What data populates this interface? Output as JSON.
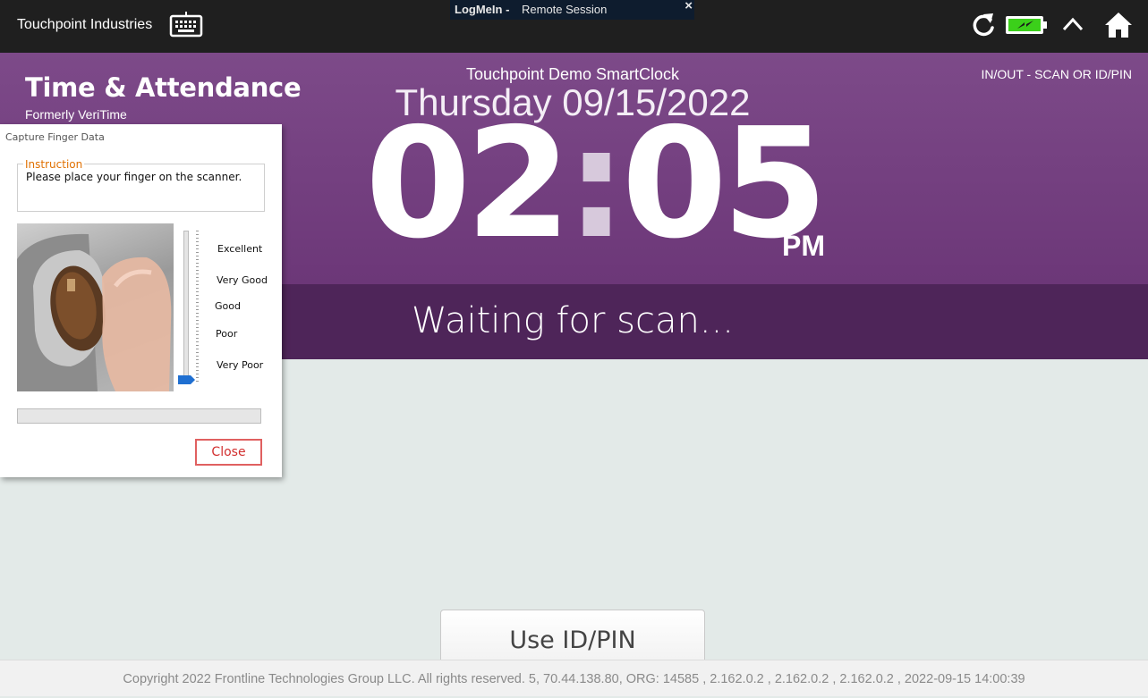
{
  "topbar": {
    "company": "Touchpoint Industries",
    "icons": [
      "keyboard-icon",
      "refresh-icon",
      "battery-icon",
      "collapse-caret-icon",
      "home-icon"
    ],
    "battery_color": "#3bd01a"
  },
  "remote_session": {
    "brand": "LogMeIn",
    "separator": "-",
    "label": "Remote Session",
    "close": "×"
  },
  "hero": {
    "app_title": "Time & Attendance",
    "app_subtitle": "Formerly VeriTime",
    "device_name": "Touchpoint Demo SmartClock",
    "date": "Thursday 09/15/2022",
    "mode_hint": "IN/OUT - SCAN OR ID/PIN",
    "time_hours": "02",
    "time_colon": ":",
    "time_minutes": "05",
    "ampm": "PM",
    "status": "Waiting for scan...",
    "accent": "#7a4586",
    "band": "#4e2559"
  },
  "dialog": {
    "title": "Capture Finger Data",
    "instruction_legend": "Instruction",
    "instruction_text": "Please place your finger on the scanner.",
    "quality_levels": [
      "Excellent",
      "Very Good",
      "Good",
      "Poor",
      "Very Poor"
    ],
    "quality_value": 0,
    "progress": 0,
    "close_label": "Close"
  },
  "main": {
    "idpin_label": "Use ID/PIN"
  },
  "footer": {
    "text": "Copyright 2022 Frontline Technologies Group LLC. All rights reserved. 5, 70.44.138.80, ORG: 14585 , 2.162.0.2 , 2.162.0.2 , 2.162.0.2 , 2022-09-15 14:00:39"
  }
}
